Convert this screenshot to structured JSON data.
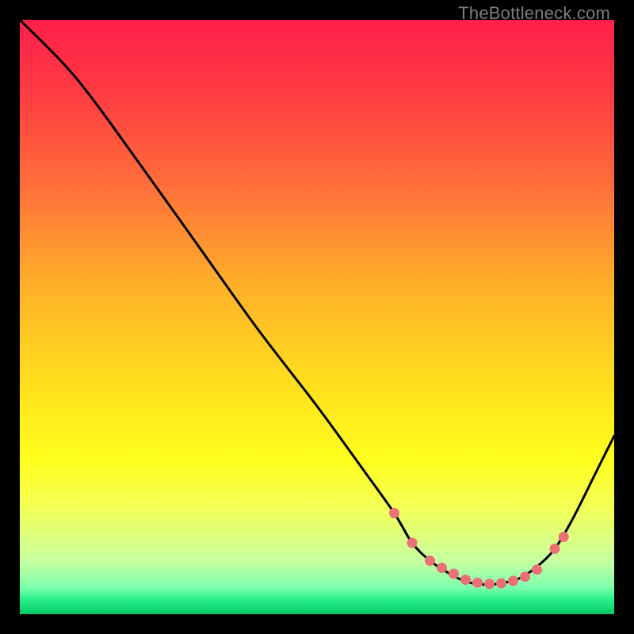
{
  "watermark": "TheBottleneck.com",
  "colors": {
    "dot": "#eb7077",
    "curve": "#000000",
    "gradient_stops": [
      {
        "offset": 0.0,
        "color": "#ff1f4b"
      },
      {
        "offset": 0.12,
        "color": "#ff3a42"
      },
      {
        "offset": 0.28,
        "color": "#ff6f3a"
      },
      {
        "offset": 0.45,
        "color": "#ffb129"
      },
      {
        "offset": 0.62,
        "color": "#ffe11d"
      },
      {
        "offset": 0.74,
        "color": "#ffff1d"
      },
      {
        "offset": 0.82,
        "color": "#f4ff55"
      },
      {
        "offset": 0.91,
        "color": "#c8ffa0"
      },
      {
        "offset": 0.955,
        "color": "#7dffad"
      },
      {
        "offset": 0.975,
        "color": "#29f18b"
      },
      {
        "offset": 1.0,
        "color": "#06c765"
      }
    ]
  },
  "chart_data": {
    "type": "line",
    "title": "",
    "xlabel": "",
    "ylabel": "",
    "xlim": [
      0,
      100
    ],
    "ylim": [
      0,
      100
    ],
    "grid": false,
    "series": [
      {
        "name": "curve",
        "x": [
          0,
          7,
          12,
          20,
          30,
          40,
          50,
          58,
          63,
          66,
          69,
          72,
          75,
          78,
          81,
          84,
          87,
          90,
          93,
          97,
          100
        ],
        "y": [
          100,
          93,
          87,
          76,
          62,
          48,
          35,
          24,
          17,
          12,
          9,
          7,
          5.5,
          5,
          5.2,
          6,
          8,
          11,
          16,
          24,
          30
        ]
      }
    ],
    "markers": {
      "name": "dots",
      "x": [
        63,
        66,
        69,
        71,
        73,
        75,
        77,
        79,
        81,
        83,
        85,
        87,
        90,
        91.5
      ],
      "y": [
        17,
        12,
        9,
        7.8,
        6.8,
        5.8,
        5.3,
        5.1,
        5.2,
        5.6,
        6.3,
        7.5,
        11,
        13
      ]
    }
  }
}
